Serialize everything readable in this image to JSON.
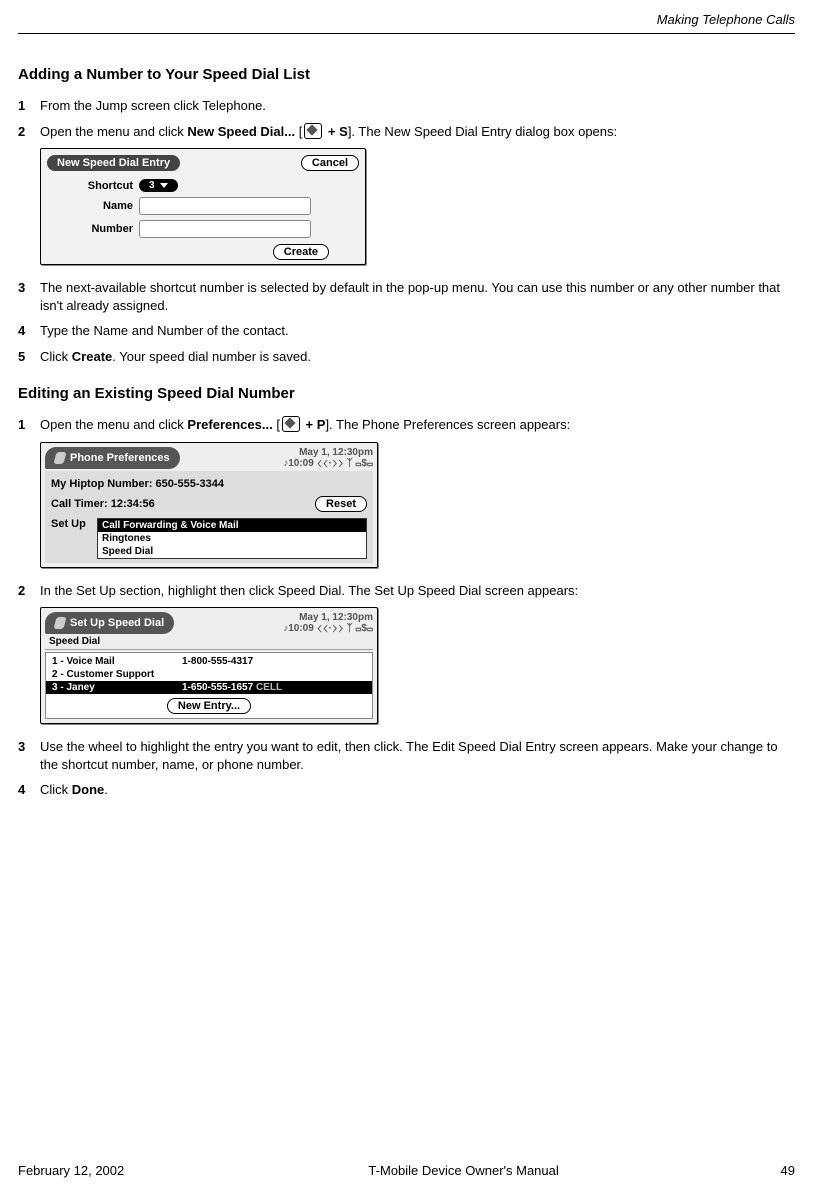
{
  "header": {
    "section_title": "Making Telephone Calls"
  },
  "section1": {
    "heading": "Adding a Number to Your Speed Dial List",
    "steps": {
      "s1": {
        "num": "1",
        "text": "From the Jump screen click Telephone."
      },
      "s2": {
        "num": "2",
        "pre": "Open the menu and click ",
        "bold": "New Speed Dial...",
        "post_bracket_open": " [",
        "key": " + S",
        "post_bracket_close": "]. The New Speed Dial Entry dialog box opens:"
      },
      "s3": {
        "num": "3",
        "text": "The next-available shortcut number is selected by default in the pop-up menu. You can use this number or any other number that isn't already assigned."
      },
      "s4": {
        "num": "4",
        "text": "Type the Name and Number of the contact."
      },
      "s5": {
        "num": "5",
        "pre": "Click ",
        "bold": "Create",
        "post": ". Your speed dial number is saved."
      }
    },
    "dialog": {
      "title": "New Speed Dial Entry",
      "cancel": "Cancel",
      "shortcut_label": "Shortcut",
      "shortcut_value": "3",
      "name_label": "Name",
      "number_label": "Number",
      "create": "Create"
    }
  },
  "section2": {
    "heading": "Editing an Existing Speed Dial Number",
    "steps": {
      "s1": {
        "num": "1",
        "pre": "Open the menu and click ",
        "bold": "Preferences...",
        "post_bracket_open": " [",
        "key": " + P",
        "post_bracket_close": "]. The Phone Preferences screen appears:"
      },
      "s2": {
        "num": "2",
        "text": "In the Set Up section, highlight then click Speed Dial. The Set Up Speed Dial screen appears:"
      },
      "s3": {
        "num": "3",
        "text": "Use the wheel to highlight the entry you want to edit, then click. The Edit Speed Dial Entry screen appears. Make your change to the shortcut number, name, or phone number."
      },
      "s4": {
        "num": "4",
        "pre": "Click ",
        "bold": "Done",
        "post": "."
      }
    },
    "prefs": {
      "tab": "Phone Preferences",
      "date": "May 1, 12:30pm",
      "time_icons": "♪10:09  ⟨⟨·⟩⟩ ᛉ ▭$▭",
      "my_number_line": "My Hiptop Number: 650-555-3344",
      "call_timer": "Call Timer: 12:34:56",
      "reset": "Reset",
      "setup_label": "Set Up",
      "items": {
        "i1": "Call Forwarding & Voice Mail",
        "i2": "Ringtones",
        "i3": "Speed Dial"
      }
    },
    "speed": {
      "tab": "Set Up Speed Dial",
      "date": "May 1, 12:30pm",
      "time_icons": "♪10:09  ⟨⟨·⟩⟩ ᛉ ▭$▭",
      "section_label": "Speed Dial",
      "rows": {
        "r1": {
          "name": "1 - Voice Mail",
          "num": "1-800-555-4317",
          "type": ""
        },
        "r2": {
          "name": "2 - Customer Support",
          "num": "",
          "type": ""
        },
        "r3": {
          "name": "3 - Janey",
          "num": "1-650-555-1657",
          "type": "CELL"
        }
      },
      "new_entry": "New Entry..."
    }
  },
  "footer": {
    "date": "February 12, 2002",
    "manual": "T-Mobile Device Owner's Manual",
    "page": "49"
  }
}
